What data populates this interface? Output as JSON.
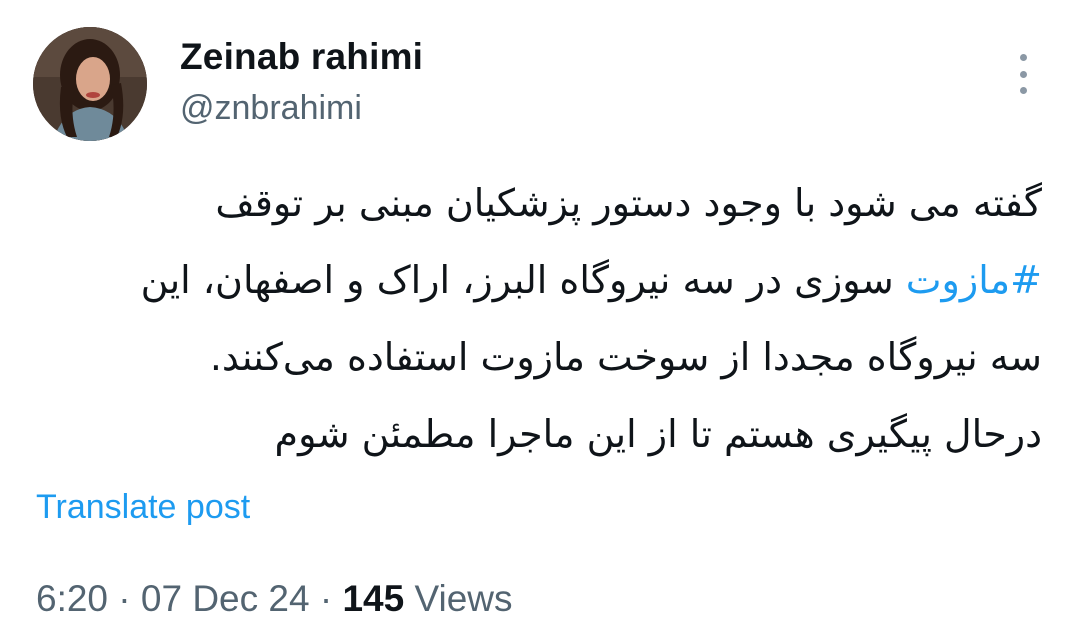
{
  "author": {
    "display_name": "Zeinab rahimi",
    "handle": "@znbrahimi",
    "avatar": "profile-photo"
  },
  "menu": {
    "icon": "more-vertical-icon"
  },
  "post": {
    "lines": [
      {
        "text": "گفته می شود با وجود دستور پزشکیان مبنی بر توقف"
      },
      {
        "hashtag": "#مازوت",
        "text": " سوزی در سه نیروگاه البرز، اراک و اصفهان، این"
      },
      {
        "text": "سه نیروگاه مجددا از سوخت مازوت استفاده می‌کنند."
      },
      {
        "text": "درحال پیگیری هستم تا از این ماجرا مطمئن شوم"
      }
    ]
  },
  "translate_label": "Translate post",
  "meta": {
    "time": "6:20",
    "separator": "·",
    "date": "07 Dec 24",
    "views_count": "145",
    "views_label": "Views"
  },
  "colors": {
    "link": "#1d9bf0",
    "secondary_text": "#536471",
    "primary_text": "#0f1419"
  }
}
